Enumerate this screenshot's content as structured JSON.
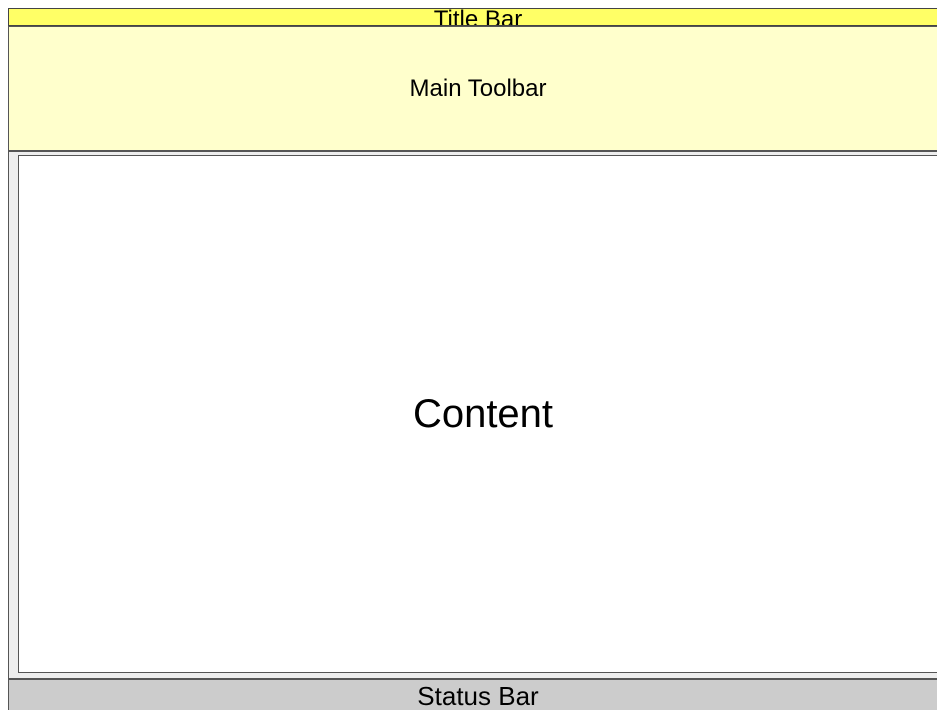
{
  "title_bar": {
    "label": "Title Bar",
    "color": "#ffff66"
  },
  "main_toolbar": {
    "label": "Main Toolbar",
    "color": "#ffffcc"
  },
  "content": {
    "label": "Content",
    "color": "#ffffff"
  },
  "status_bar": {
    "label": "Status Bar",
    "color": "#cccccc"
  }
}
